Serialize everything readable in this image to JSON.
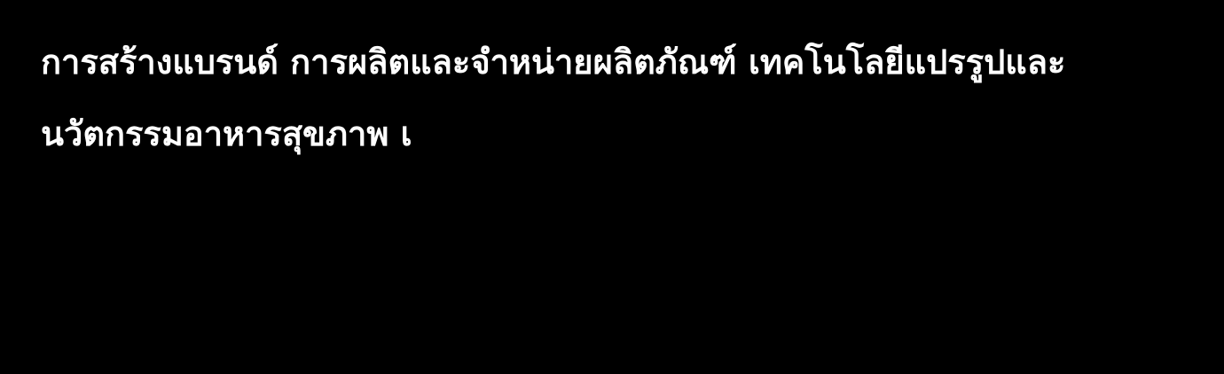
{
  "colors": {
    "background": "#000000",
    "text": "#ffffff"
  },
  "content": {
    "lines": [
      "การสร้างแบรนด์ การผลิตและจำหน่ายผลิตภัณฑ์ เทคโนโลยีแปรรูปและ",
      "นวัตกรรมอาหารสุขภาพ เ"
    ]
  }
}
